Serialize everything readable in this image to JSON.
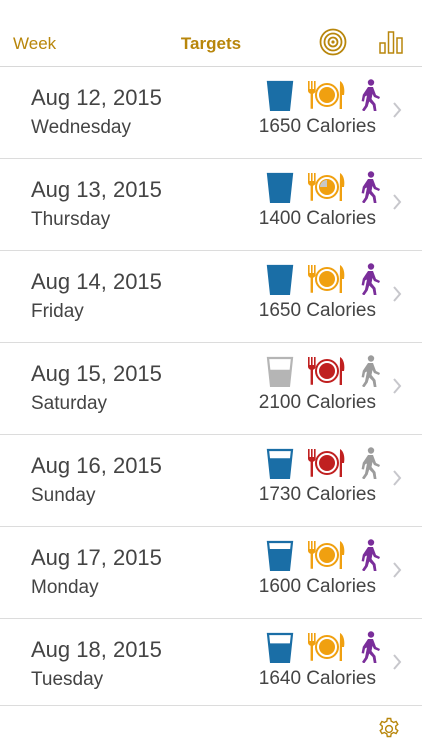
{
  "nav": {
    "left_label": "Week",
    "title": "Targets",
    "target_icon": "target-icon",
    "chart_icon": "bar-chart-icon",
    "accent": "#b8860b"
  },
  "colors": {
    "water_full": "#1a6ea6",
    "water_low": "#b5b5b5",
    "meal_good": "#f0a010",
    "meal_over": "#c02020",
    "walk_active": "#7a2e9a",
    "walk_inactive": "#9c9c9c"
  },
  "days": [
    {
      "date": "Aug 12, 2015",
      "weekday": "Wednesday",
      "calories": "1650 Calories",
      "water": "full",
      "meal": "good",
      "meal_partial": false,
      "walk": "active",
      "water_fill": 1.0
    },
    {
      "date": "Aug 13, 2015",
      "weekday": "Thursday",
      "calories": "1400 Calories",
      "water": "full",
      "meal": "good",
      "meal_partial": true,
      "walk": "active",
      "water_fill": 1.0
    },
    {
      "date": "Aug 14, 2015",
      "weekday": "Friday",
      "calories": "1650 Calories",
      "water": "full",
      "meal": "good",
      "meal_partial": false,
      "walk": "active",
      "water_fill": 1.0
    },
    {
      "date": "Aug 15, 2015",
      "weekday": "Saturday",
      "calories": "2100 Calories",
      "water": "low",
      "meal": "over",
      "meal_partial": false,
      "walk": "inactive",
      "water_fill": 0.55
    },
    {
      "date": "Aug 16, 2015",
      "weekday": "Sunday",
      "calories": "1730 Calories",
      "water": "full",
      "meal": "over",
      "meal_partial": false,
      "walk": "inactive",
      "water_fill": 0.7
    },
    {
      "date": "Aug 17, 2015",
      "weekday": "Monday",
      "calories": "1600 Calories",
      "water": "full",
      "meal": "good",
      "meal_partial": false,
      "walk": "active",
      "water_fill": 0.75
    },
    {
      "date": "Aug 18, 2015",
      "weekday": "Tuesday",
      "calories": "1640 Calories",
      "water": "full",
      "meal": "good",
      "meal_partial": false,
      "walk": "active",
      "water_fill": 0.65
    }
  ],
  "footer": {
    "settings_icon": "gear-icon"
  }
}
